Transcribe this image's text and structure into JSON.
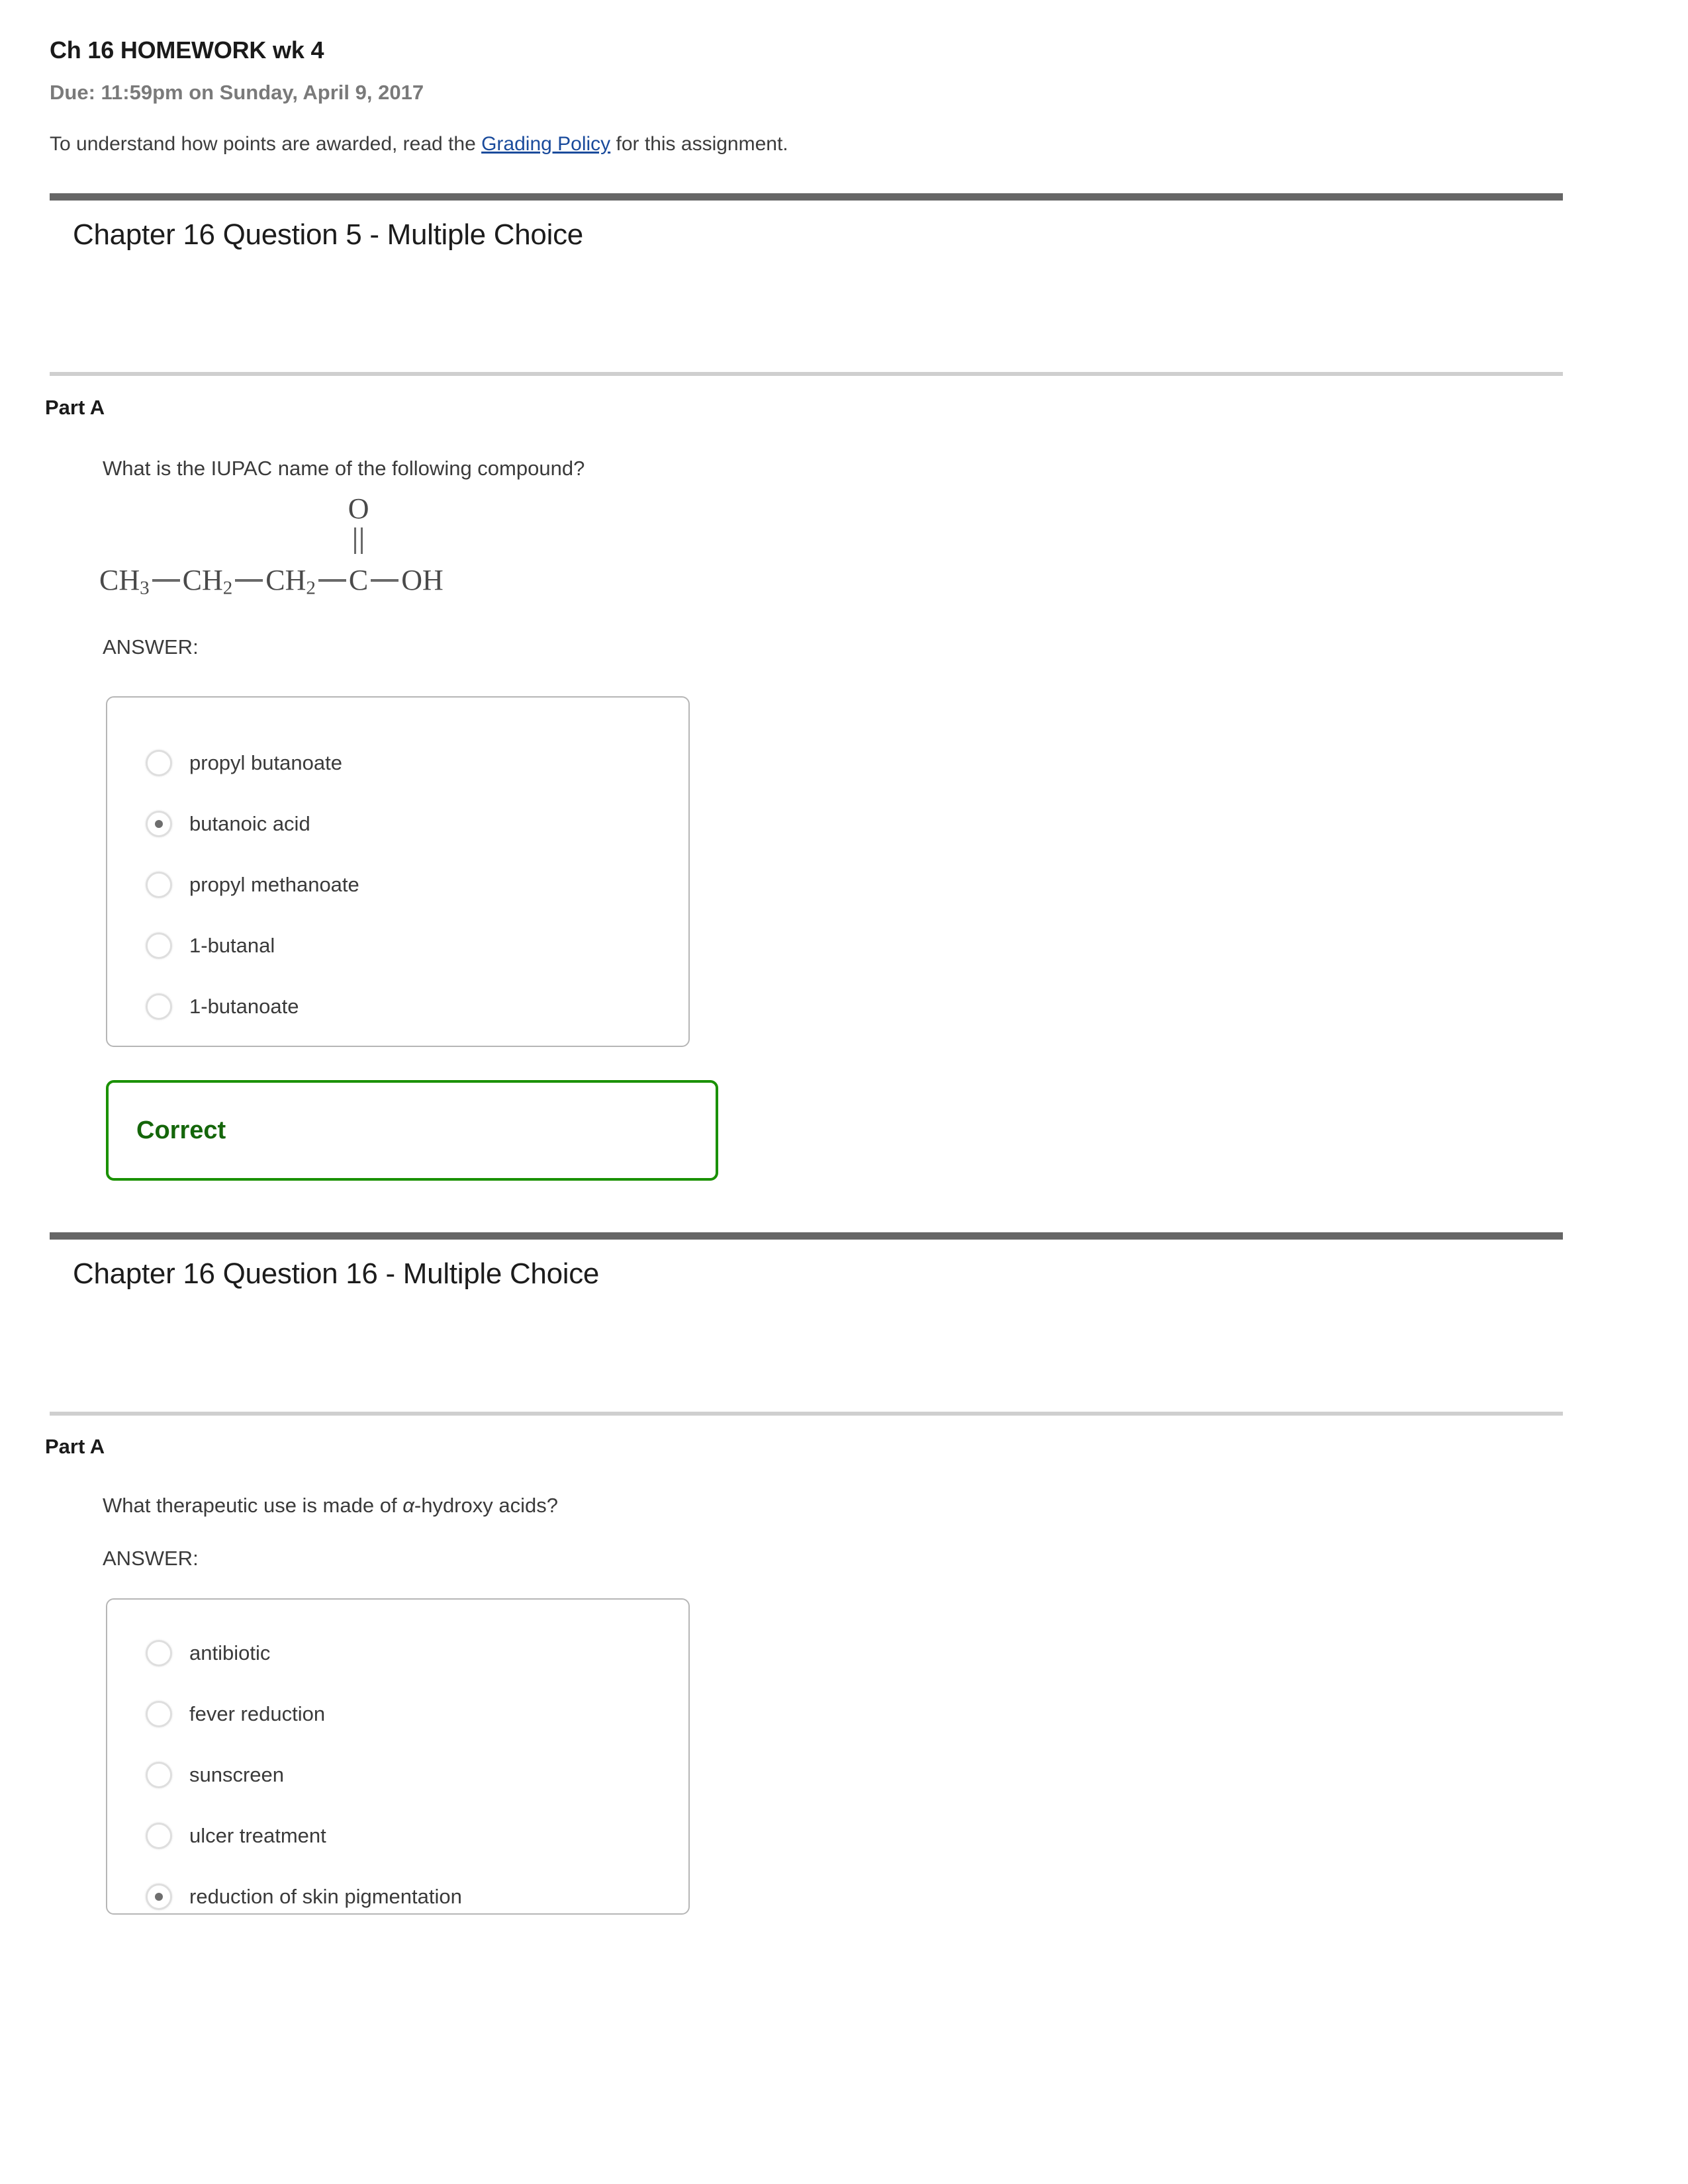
{
  "assignment": {
    "title": "Ch 16 HOMEWORK wk 4",
    "due": "Due: 11:59pm on Sunday, April 9, 2017",
    "policy_prefix": "To understand how points are awarded, read the ",
    "policy_link": "Grading Policy",
    "policy_suffix": " for this assignment."
  },
  "colors": {
    "link": "#1a4b9c",
    "correct_border": "#1a9100",
    "correct_text": "#14660a",
    "rule_dark": "#666666",
    "rule_light": "#cfcfcf"
  },
  "questions": [
    {
      "title": "Chapter 16 Question 5 - Multiple Choice",
      "part_label": "Part A",
      "prompt": "What is the IUPAC name of the following compound?",
      "answer_label": "ANSWER:",
      "structure": {
        "type": "condensed-structural-formula",
        "compound": "butanoic acid",
        "segments": [
          "CH",
          "3",
          "CH",
          "2",
          "CH",
          "2",
          "C",
          "OH"
        ],
        "carbonyl_atom": "O",
        "plain": "CH3-CH2-CH2-C(=O)-OH",
        "g1": "CH",
        "g1s": "3",
        "g2": "CH",
        "g2s": "2",
        "g3": "CH",
        "g3s": "2",
        "g4": "C",
        "g5": "OH",
        "dbl_o": "O"
      },
      "choices": [
        {
          "label": "propyl butanoate",
          "selected": false
        },
        {
          "label": "butanoic acid",
          "selected": true
        },
        {
          "label": "propyl methanoate",
          "selected": false
        },
        {
          "label": "1-butanal",
          "selected": false
        },
        {
          "label": "1-butanoate",
          "selected": false
        }
      ],
      "feedback": "Correct"
    },
    {
      "title": "Chapter 16 Question 16 - Multiple Choice",
      "part_label": "Part A",
      "prompt_before": "What therapeutic use is made of ",
      "prompt_greek": "α",
      "prompt_after": "-hydroxy acids?",
      "answer_label": "ANSWER:",
      "choices": [
        {
          "label": "antibiotic",
          "selected": false
        },
        {
          "label": "fever reduction",
          "selected": false
        },
        {
          "label": "sunscreen",
          "selected": false
        },
        {
          "label": "ulcer treatment",
          "selected": false
        },
        {
          "label": "reduction of skin pigmentation",
          "selected": true
        }
      ]
    }
  ],
  "icons": {
    "radio_unchecked": "radio-unchecked-icon",
    "radio_checked": "radio-checked-icon"
  }
}
